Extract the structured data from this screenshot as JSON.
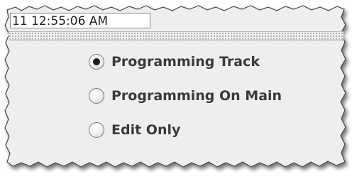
{
  "status": {
    "clock_text": "11 12:55:06 AM"
  },
  "programming_mode": {
    "options": [
      {
        "label": "Programming Track",
        "selected": true
      },
      {
        "label": "Programming On Main",
        "selected": false
      },
      {
        "label": "Edit Only",
        "selected": false
      }
    ]
  },
  "colors": {
    "panel_background": "#eeeeee",
    "label_text": "#3a3a3a",
    "selected_dot": "#1c1c1c"
  }
}
